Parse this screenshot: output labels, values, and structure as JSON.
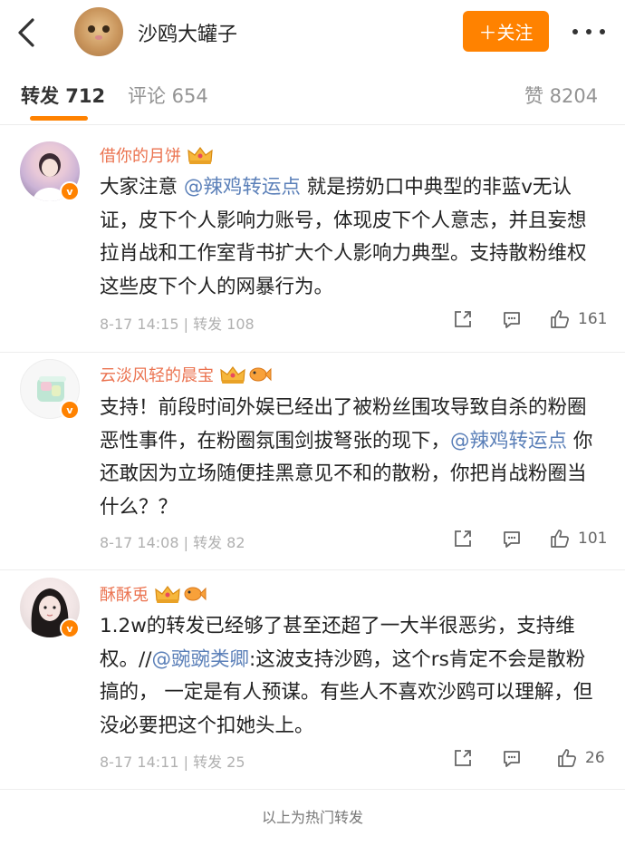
{
  "header": {
    "back_icon": "chevron-left-icon",
    "avatar_icon": "cat-avatar",
    "title": "沙鸥大罐子",
    "follow_label": "＋关注",
    "more_icon": "more-dots-icon",
    "accent_color": "#ff8200"
  },
  "tabs": {
    "repost": "转发 712",
    "comment": "评论 654",
    "like": "赞 8204"
  },
  "comments": [
    {
      "username": "借你的月饼",
      "badges": [
        "crown-badge"
      ],
      "content_before": "大家注意 ",
      "mention": "@辣鸡转运点",
      "content_after": " 就是捞奶口中典型的非蓝v无认证，皮下个人影响力账号，体现皮下个人意志，并且妄想拉肖战和工作室背书扩大个人影响力典型。支持散粉维权这些皮下个人的网暴行为。",
      "time": "8-17 14:15",
      "repost": "转发 108",
      "likes": "161"
    },
    {
      "username": "云淡风轻的晨宝",
      "badges": [
        "crown-badge",
        "fish-badge"
      ],
      "content_before": "支持！前段时间外娱已经出了被粉丝围攻导致自杀的粉圈恶性事件，在粉圈氛围剑拔弩张的现下，",
      "mention": "@辣鸡转运点",
      "content_after": " 你还敢因为立场随便挂黑意见不和的散粉，你把肖战粉圈当什么？？",
      "time": "8-17 14:08",
      "repost": "转发 82",
      "likes": "101"
    },
    {
      "username": "酥酥兎",
      "badges": [
        "crown-badge",
        "fish-badge"
      ],
      "content_before": "1.2w的转发已经够了甚至还超了一大半很恶劣，支持维权。//",
      "mention": "@豌豌类卿",
      "content_after": ":这波支持沙鸥，这个rs肯定不会是散粉搞的， 一定是有人预谋。有些人不喜欢沙鸥可以理解，但没必要把这个扣她头上。",
      "time": "8-17 14:11",
      "repost": "转发 25",
      "likes": "26"
    }
  ],
  "footer_note": "以上为热门转发",
  "colors": {
    "username": "#eb7350",
    "mention": "#5a7fb8",
    "meta": "#b0b0b0"
  }
}
